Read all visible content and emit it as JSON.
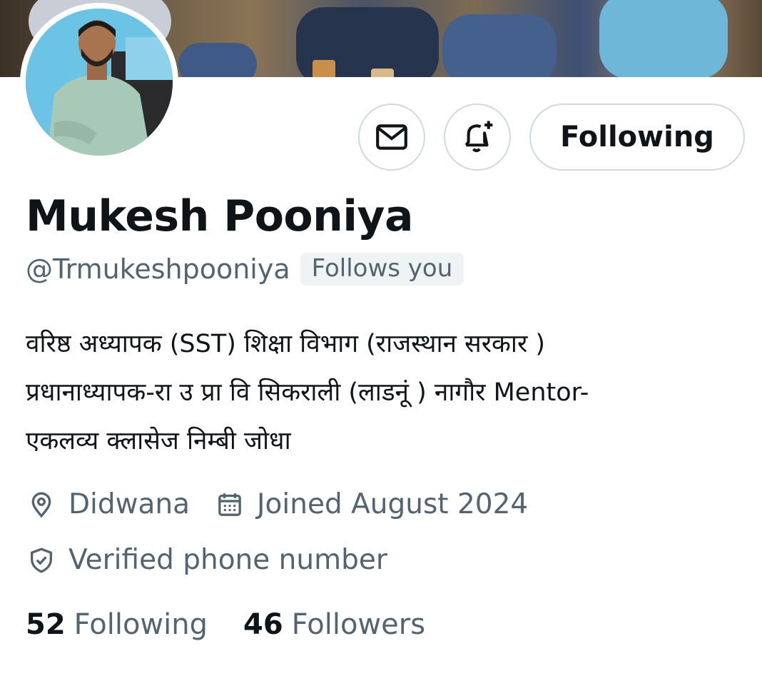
{
  "profile": {
    "name": "Mukesh Pooniya",
    "handle": "@Trmukeshpooniya",
    "follows_you": "Follows you",
    "bio": "वरिष्ठ अध्यापक (SST) शिक्षा विभाग (राजस्थान सरकार )\nप्रधानाध्यापक-रा उ प्रा वि सिकराली (लाडनूं ) नागौर Mentor-\nएकलव्य क्लासेज निम्बी जोधा",
    "location": "Didwana",
    "joined": "Joined August 2024",
    "verified": "Verified phone number"
  },
  "actions": {
    "message_icon": "mail-icon",
    "notify_icon": "bell-plus-icon",
    "follow_label": "Following"
  },
  "stats": {
    "following_count": "52",
    "following_label": "Following",
    "followers_count": "46",
    "followers_label": "Followers"
  },
  "colors": {
    "text_primary": "#0f1419",
    "text_secondary": "#536471",
    "border": "#cfd9de",
    "badge_bg": "#eff3f4",
    "avatar_bg": "#6bc3e6"
  }
}
